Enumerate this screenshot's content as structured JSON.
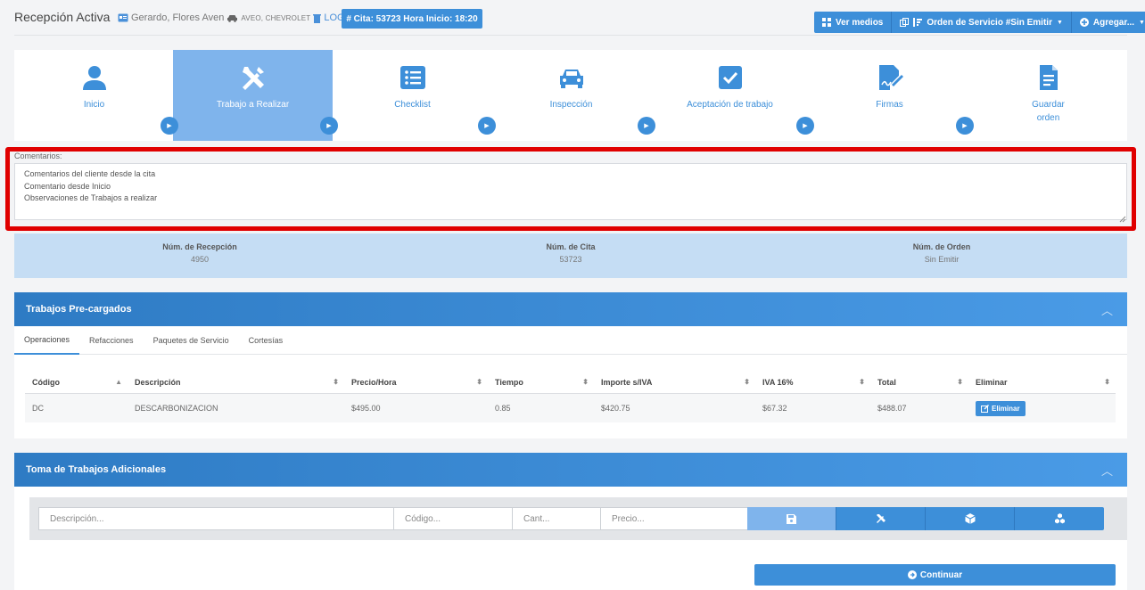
{
  "header": {
    "title": "Recepción Activa",
    "client": "Gerardo, Flores Aven",
    "vehicle": "AVEO, CHEVROLET",
    "log": "LOG",
    "cita_button": "# Cita: 53723 Hora Inicio: 18:20",
    "buttons": {
      "ver_medios": "Ver medios",
      "orden_servicio": "Orden de Servicio #Sin Emitir",
      "agregar": "Agregar..."
    }
  },
  "steps": [
    {
      "label": "Inicio",
      "icon": "user-icon"
    },
    {
      "label": "Trabajo a Realizar",
      "icon": "tools-icon"
    },
    {
      "label": "Checklist",
      "icon": "list-icon"
    },
    {
      "label": "Inspección",
      "icon": "car-icon"
    },
    {
      "label": "Aceptación de trabajo",
      "icon": "check-icon"
    },
    {
      "label": "Firmas",
      "icon": "signature-icon"
    },
    {
      "label": "Guardar\norden",
      "icon": "document-icon"
    }
  ],
  "active_step": 1,
  "comments": {
    "label": "Comentarios:",
    "text": "Comentarios del cliente desde la cita\nComentario desde Inicio\nObservaciones de Trabajos a realizar"
  },
  "numbers": [
    {
      "label": "Núm. de Recepción",
      "value": "4950"
    },
    {
      "label": "Núm. de Cita",
      "value": "53723"
    },
    {
      "label": "Núm. de Orden",
      "value": "Sin Emitir"
    }
  ],
  "precargados": {
    "title": "Trabajos Pre-cargados",
    "tabs": [
      "Operaciones",
      "Refacciones",
      "Paquetes de Servicio",
      "Cortesías"
    ],
    "columns": [
      "Código",
      "Descripción",
      "Precio/Hora",
      "Tiempo",
      "Importe s/IVA",
      "IVA 16%",
      "Total",
      "Eliminar"
    ],
    "rows": [
      {
        "codigo": "DC",
        "descripcion": "DESCARBONIZACION",
        "precio": "$495.00",
        "tiempo": "0.85",
        "importe": "$420.75",
        "iva": "$67.32",
        "total": "$488.07",
        "eliminar": "Eliminar"
      }
    ]
  },
  "adicionales": {
    "title": "Toma de Trabajos Adicionales",
    "placeholders": {
      "descripcion": "Descripción...",
      "codigo": "Código...",
      "cant": "Cant...",
      "precio": "Precio..."
    }
  },
  "continuar": "Continuar",
  "colors": {
    "accent": "#3d8fd9",
    "active_step": "#7fb4ec",
    "highlight_border": "#e00000",
    "numbers_bg": "#c5ddf4"
  }
}
